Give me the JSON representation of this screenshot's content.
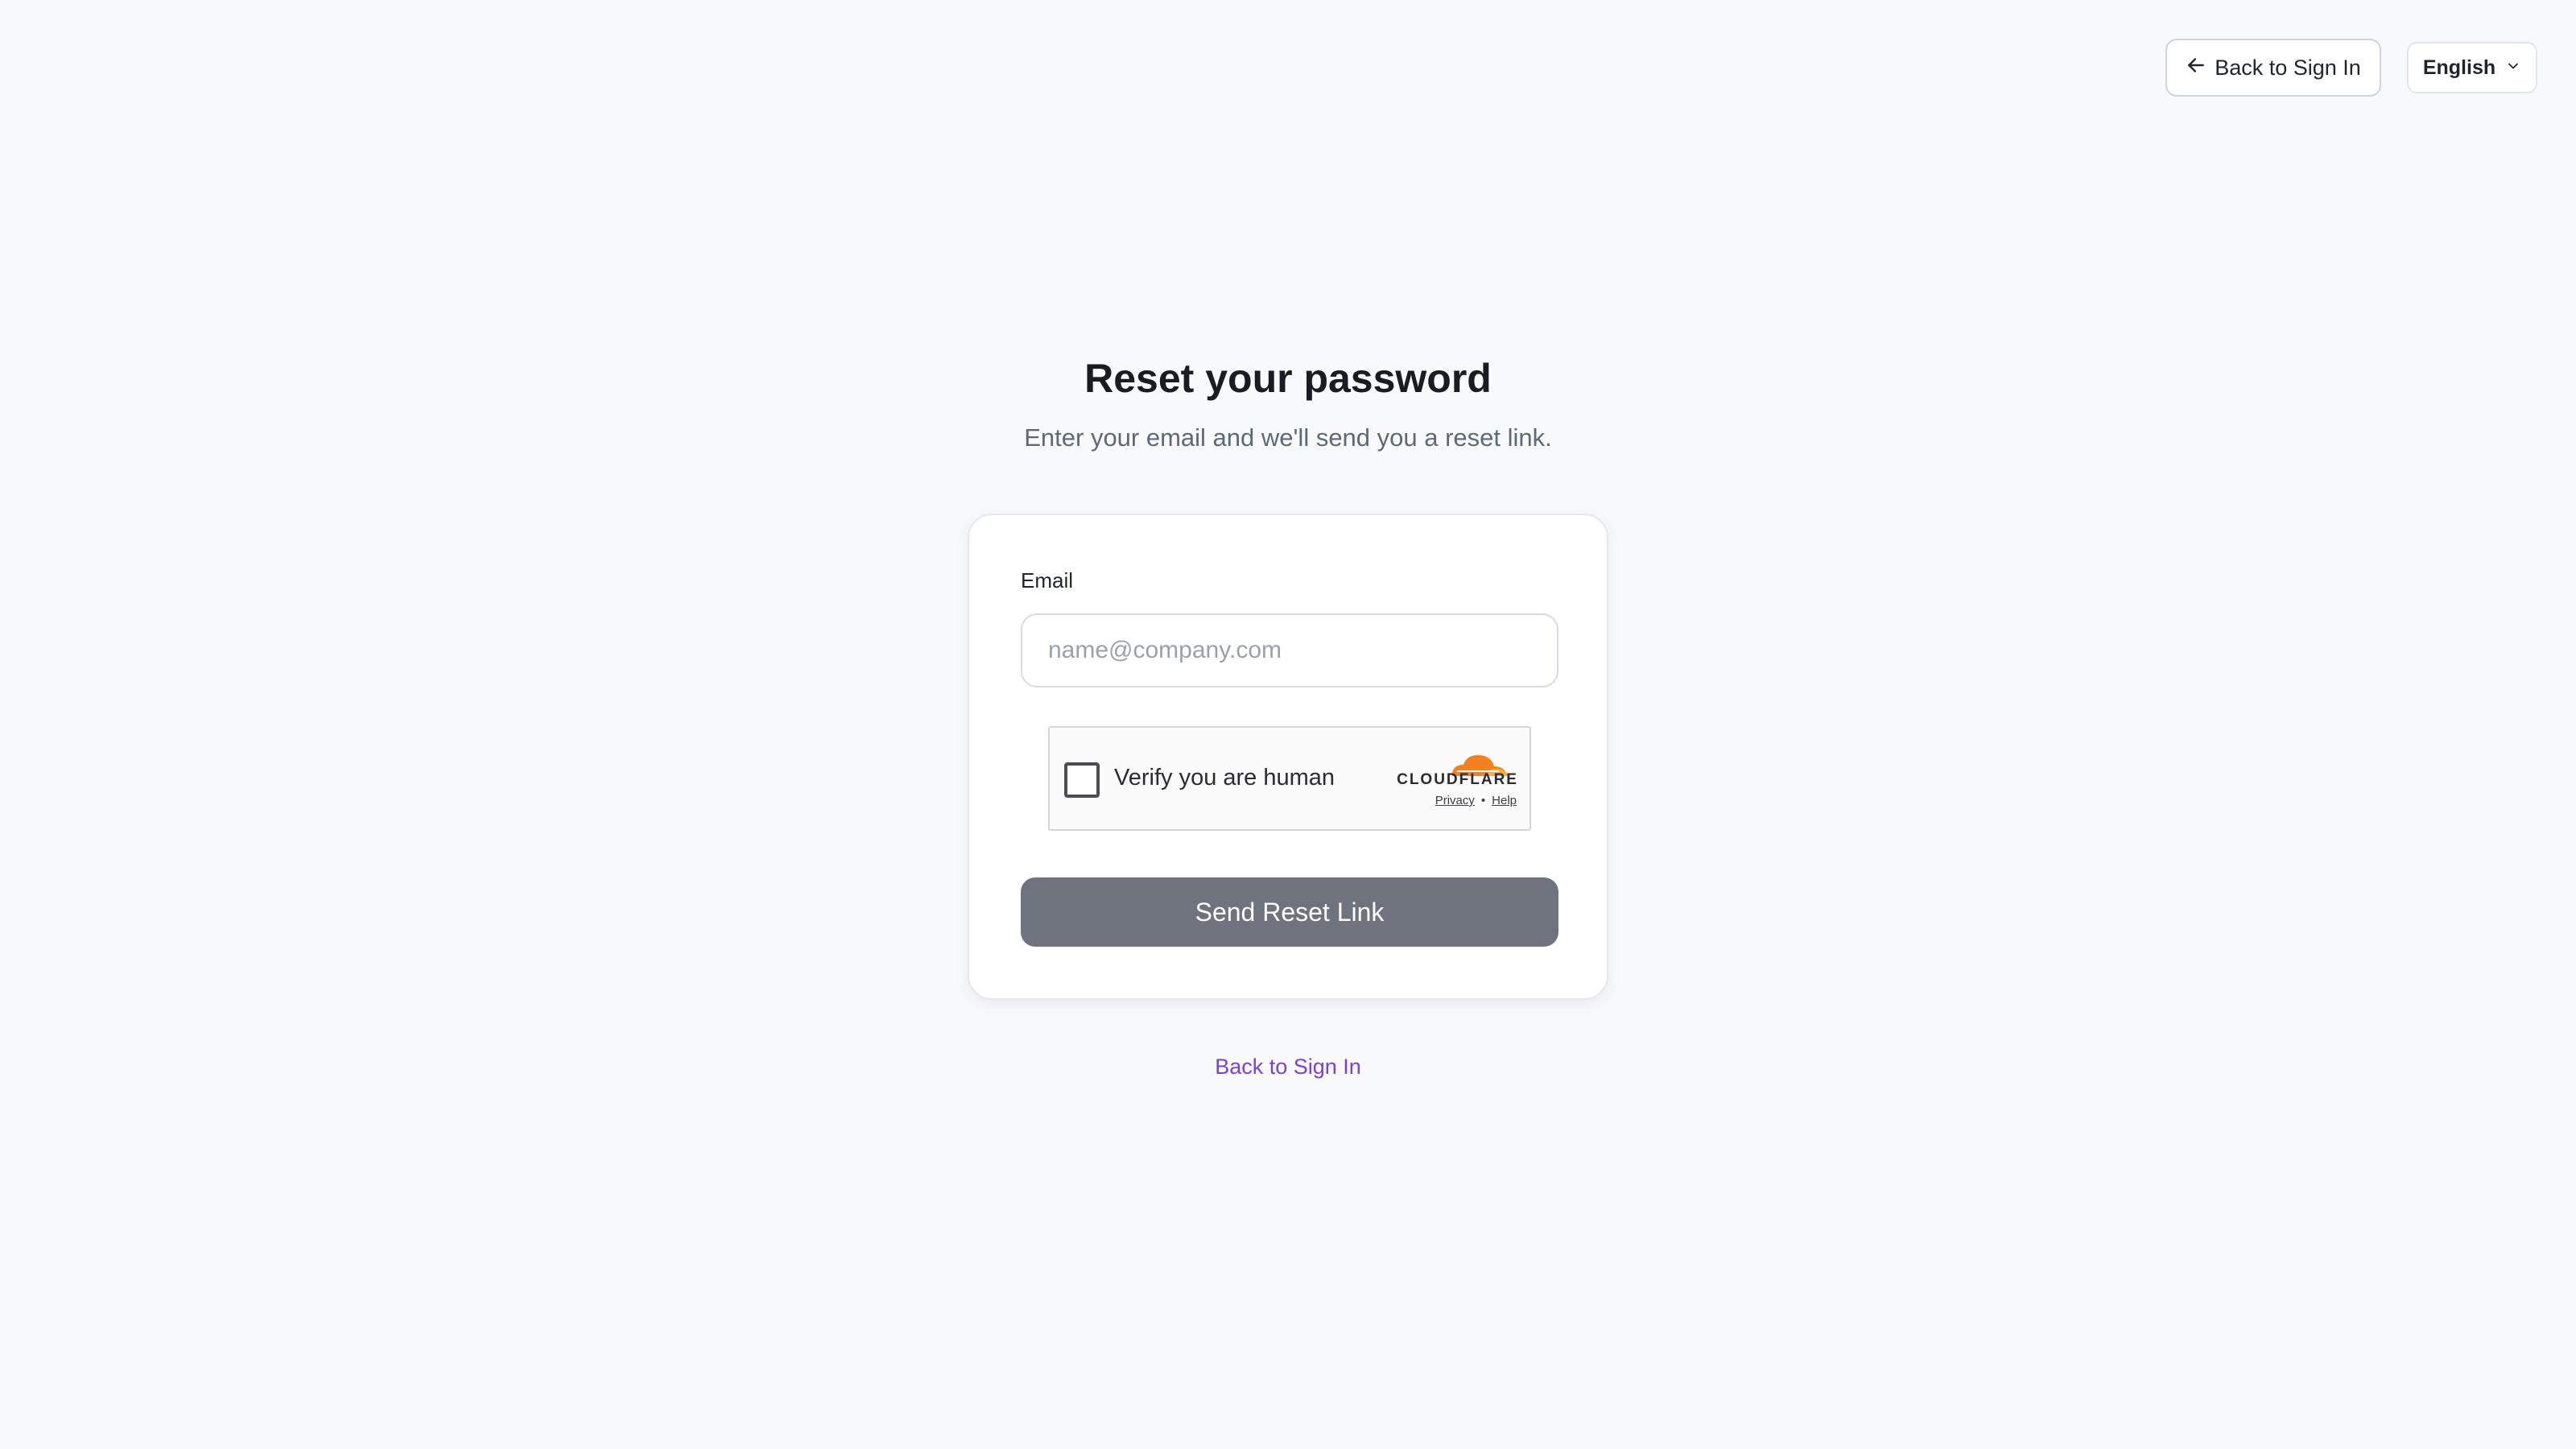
{
  "header": {
    "back_label": "Back to Sign In",
    "back_icon": "arrow-left-icon",
    "language": {
      "selected": "English",
      "icon": "chevron-down-icon"
    }
  },
  "main": {
    "title": "Reset your password",
    "subtitle": "Enter your email and we'll send you a reset link."
  },
  "form": {
    "email_label": "Email",
    "email_value": "",
    "email_placeholder": "name@company.com",
    "submit_label": "Send Reset Link"
  },
  "captcha": {
    "label": "Verify you are human",
    "brand": "CLOUDFLARE",
    "privacy_label": "Privacy",
    "separator": "•",
    "help_label": "Help",
    "checked": false
  },
  "footer": {
    "back_link_label": "Back to Sign In"
  },
  "colors": {
    "background": "#f8f9fb",
    "button": "#6e737d",
    "link": "#7b3fe0",
    "cloudflare_orange": "#f48120"
  }
}
